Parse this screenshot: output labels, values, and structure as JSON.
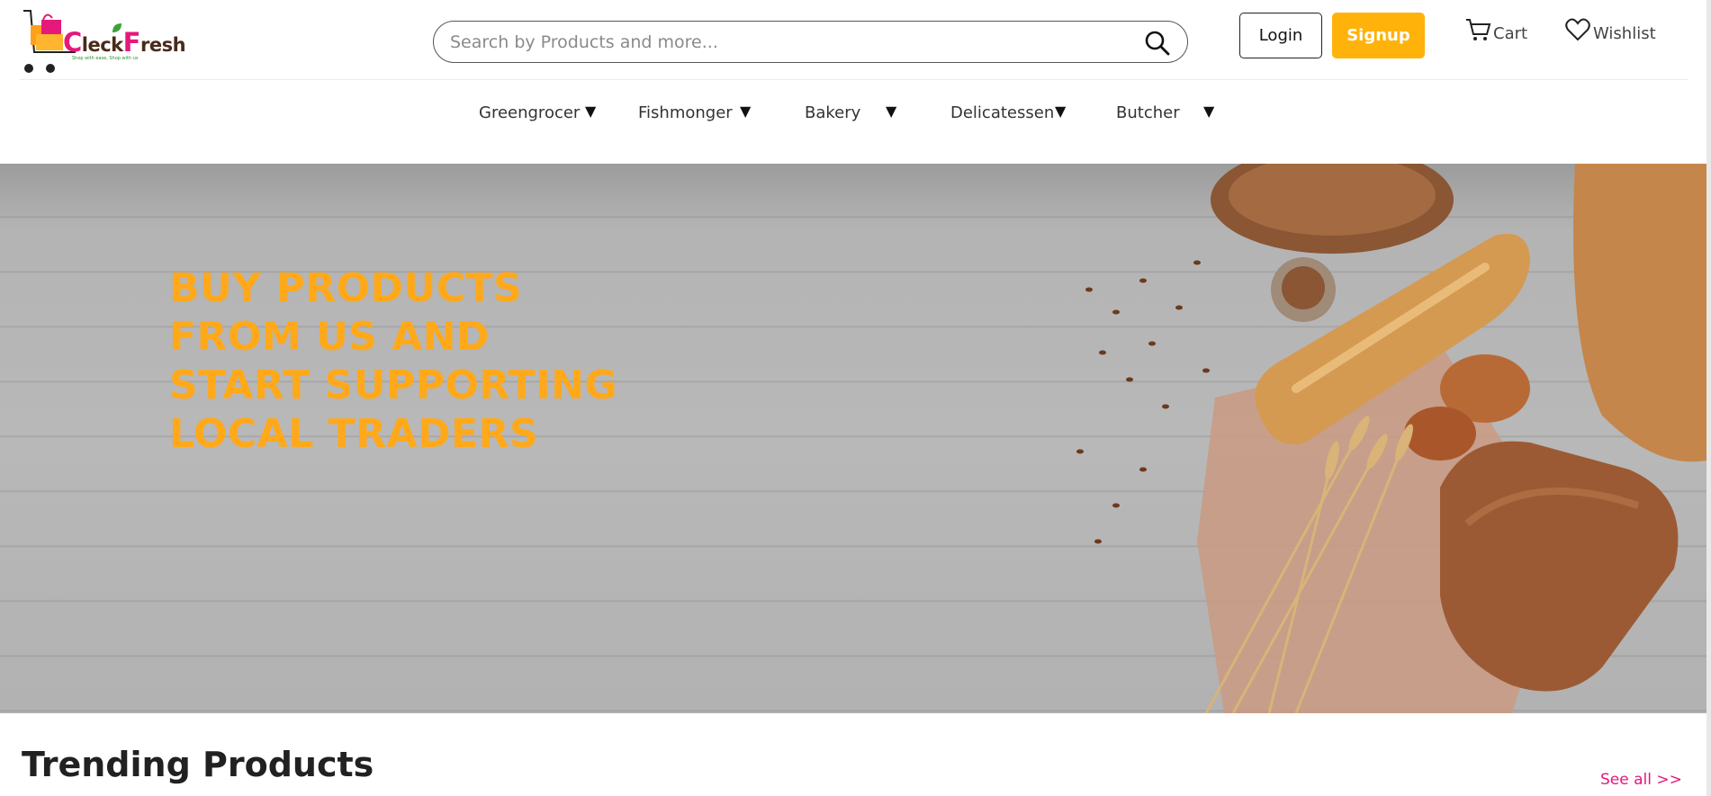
{
  "brand": {
    "name_first": "C",
    "name_mid": "leck",
    "name_second": "F",
    "name_end": "resh",
    "tagline": "Shop with ease, Shop with us",
    "accent_pink": "#e5187c",
    "accent_orange": "#ffb20a"
  },
  "search": {
    "placeholder": "Search by Products and more..."
  },
  "header": {
    "login_label": "Login",
    "signup_label": "Signup",
    "cart_label": "Cart",
    "wishlist_label": "Wishlist"
  },
  "categories": [
    {
      "label": "Greengrocer",
      "icon": "triangle-down-icon"
    },
    {
      "label": "Fishmonger",
      "icon": "triangle-down-icon"
    },
    {
      "label": "Bakery",
      "icon": "triangle-down-icon"
    },
    {
      "label": "Delicatessen",
      "icon": "triangle-down-icon"
    },
    {
      "label": "Butcher",
      "icon": "triangle-down-icon"
    }
  ],
  "hero": {
    "title": "BUY PRODUCTS FROM US AND START SUPPORTING LOCAL TRADERS",
    "title_color": "#ffa91a"
  },
  "trending": {
    "title": "Trending Products",
    "see_all_label": "See all >>"
  }
}
